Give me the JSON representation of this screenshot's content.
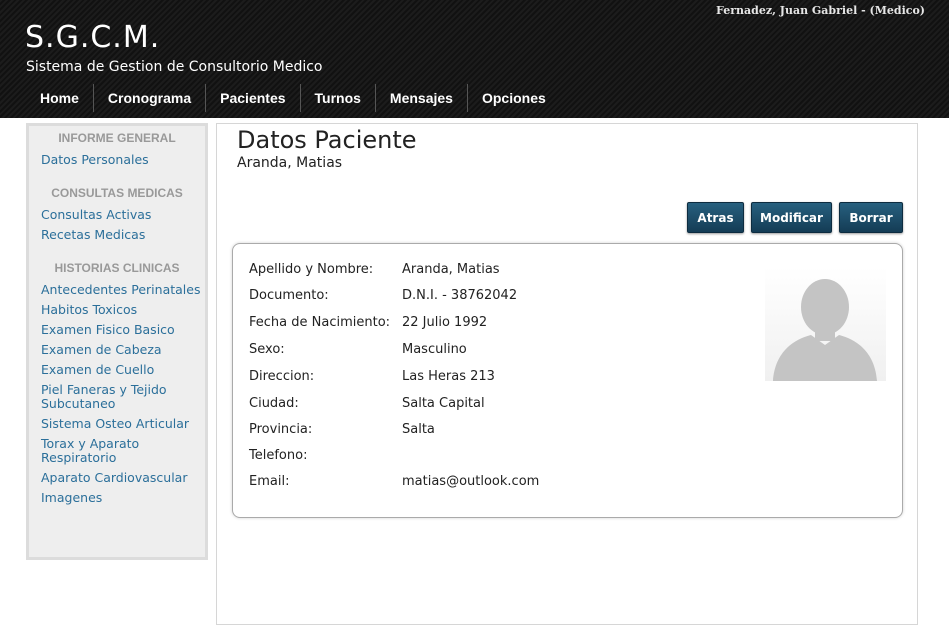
{
  "header": {
    "user": "Fernadez, Juan Gabriel - (Medico)",
    "logo": "S.G.C.M.",
    "tagline": "Sistema de Gestion de Consultorio Medico",
    "nav": [
      "Home",
      "Cronograma",
      "Pacientes",
      "Turnos",
      "Mensajes",
      "Opciones"
    ]
  },
  "sidebar": {
    "sections": [
      {
        "heading": "INFORME GENERAL",
        "links": [
          "Datos Personales"
        ]
      },
      {
        "heading": "CONSULTAS MEDICAS",
        "links": [
          "Consultas Activas",
          "Recetas Medicas"
        ]
      },
      {
        "heading": "HISTORIAS CLINICAS",
        "links": [
          "Antecedentes Perinatales",
          "Habitos Toxicos",
          "Examen Fisico Basico",
          "Examen de Cabeza",
          "Examen de Cuello",
          "Piel Faneras y Tejido Subcutaneo",
          "Sistema Osteo Articular",
          "Torax y Aparato Respiratorio",
          "Aparato Cardiovascular",
          "Imagenes"
        ]
      }
    ]
  },
  "main": {
    "title": "Datos Paciente",
    "subtitle": "Aranda, Matias",
    "buttons": {
      "back": "Atras",
      "edit": "Modificar",
      "delete": "Borrar"
    },
    "fields": [
      {
        "label": "Apellido y Nombre:",
        "value": "Aranda, Matias"
      },
      {
        "label": "Documento:",
        "value": "D.N.I. - 38762042"
      },
      {
        "label": "Fecha de Nacimiento:",
        "value": "22 Julio 1992"
      },
      {
        "label": "Sexo:",
        "value": "Masculino"
      },
      {
        "label": "Direccion:",
        "value": "Las Heras 213"
      },
      {
        "label": "Ciudad:",
        "value": "Salta Capital"
      },
      {
        "label": "Provincia:",
        "value": "Salta"
      },
      {
        "label": "Telefono:",
        "value": ""
      },
      {
        "label": "Email:",
        "value": "matias@outlook.com"
      }
    ],
    "photo_icon": "avatar-placeholder-icon"
  },
  "colors": {
    "header_bg": "#141414",
    "button": "#1f4f6b",
    "link": "#2b6f9a",
    "sidebar_bg": "#eeeeee"
  }
}
